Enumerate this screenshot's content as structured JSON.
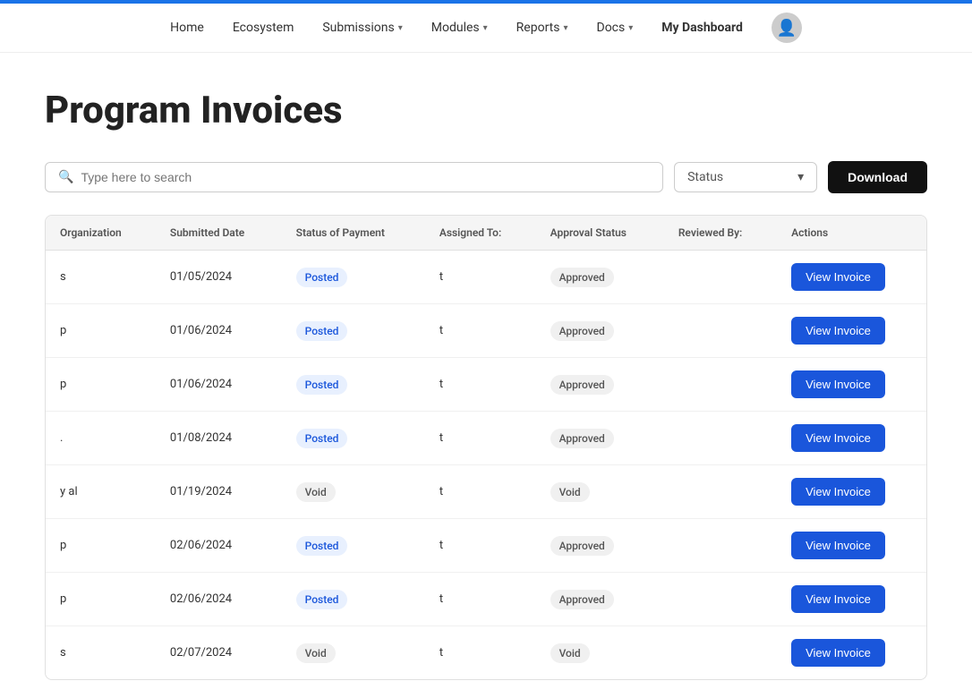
{
  "topbar": {},
  "nav": {
    "items": [
      {
        "label": "Home",
        "hasDropdown": false
      },
      {
        "label": "Ecosystem",
        "hasDropdown": false
      },
      {
        "label": "Submissions",
        "hasDropdown": true
      },
      {
        "label": "Modules",
        "hasDropdown": true
      },
      {
        "label": "Reports",
        "hasDropdown": true
      },
      {
        "label": "Docs",
        "hasDropdown": true
      },
      {
        "label": "My Dashboard",
        "hasDropdown": false,
        "active": true
      }
    ],
    "avatar_emoji": "👤"
  },
  "page": {
    "title": "Program Invoices"
  },
  "toolbar": {
    "search_placeholder": "Type here to search",
    "status_label": "Status",
    "download_label": "Download"
  },
  "table": {
    "columns": [
      "Organization",
      "Submitted Date",
      "Status of Payment",
      "Assigned To:",
      "Approval Status",
      "Reviewed By:",
      "Actions"
    ],
    "rows": [
      {
        "org": "s",
        "date": "01/05/2024",
        "payment_status": "Posted",
        "assigned_to": "t",
        "approval_status": "Approved",
        "reviewed_by": "",
        "action": "View Invoice"
      },
      {
        "org": "p",
        "date": "01/06/2024",
        "payment_status": "Posted",
        "assigned_to": "t",
        "approval_status": "Approved",
        "reviewed_by": "",
        "action": "View Invoice"
      },
      {
        "org": "p",
        "date": "01/06/2024",
        "payment_status": "Posted",
        "assigned_to": "t",
        "approval_status": "Approved",
        "reviewed_by": "",
        "action": "View Invoice"
      },
      {
        "org": ".",
        "date": "01/08/2024",
        "payment_status": "Posted",
        "assigned_to": "t",
        "approval_status": "Approved",
        "reviewed_by": "",
        "action": "View Invoice"
      },
      {
        "org": "y al",
        "date": "01/19/2024",
        "payment_status": "Void",
        "assigned_to": "t",
        "approval_status": "Void",
        "reviewed_by": "",
        "action": "View Invoice"
      },
      {
        "org": "p",
        "date": "02/06/2024",
        "payment_status": "Posted",
        "assigned_to": "t",
        "approval_status": "Approved",
        "reviewed_by": "",
        "action": "View Invoice"
      },
      {
        "org": "p",
        "date": "02/06/2024",
        "payment_status": "Posted",
        "assigned_to": "t",
        "approval_status": "Approved",
        "reviewed_by": "",
        "action": "View Invoice"
      },
      {
        "org": "s",
        "date": "02/07/2024",
        "payment_status": "Void",
        "assigned_to": "t",
        "approval_status": "Void",
        "reviewed_by": "",
        "action": "View Invoice"
      }
    ]
  }
}
